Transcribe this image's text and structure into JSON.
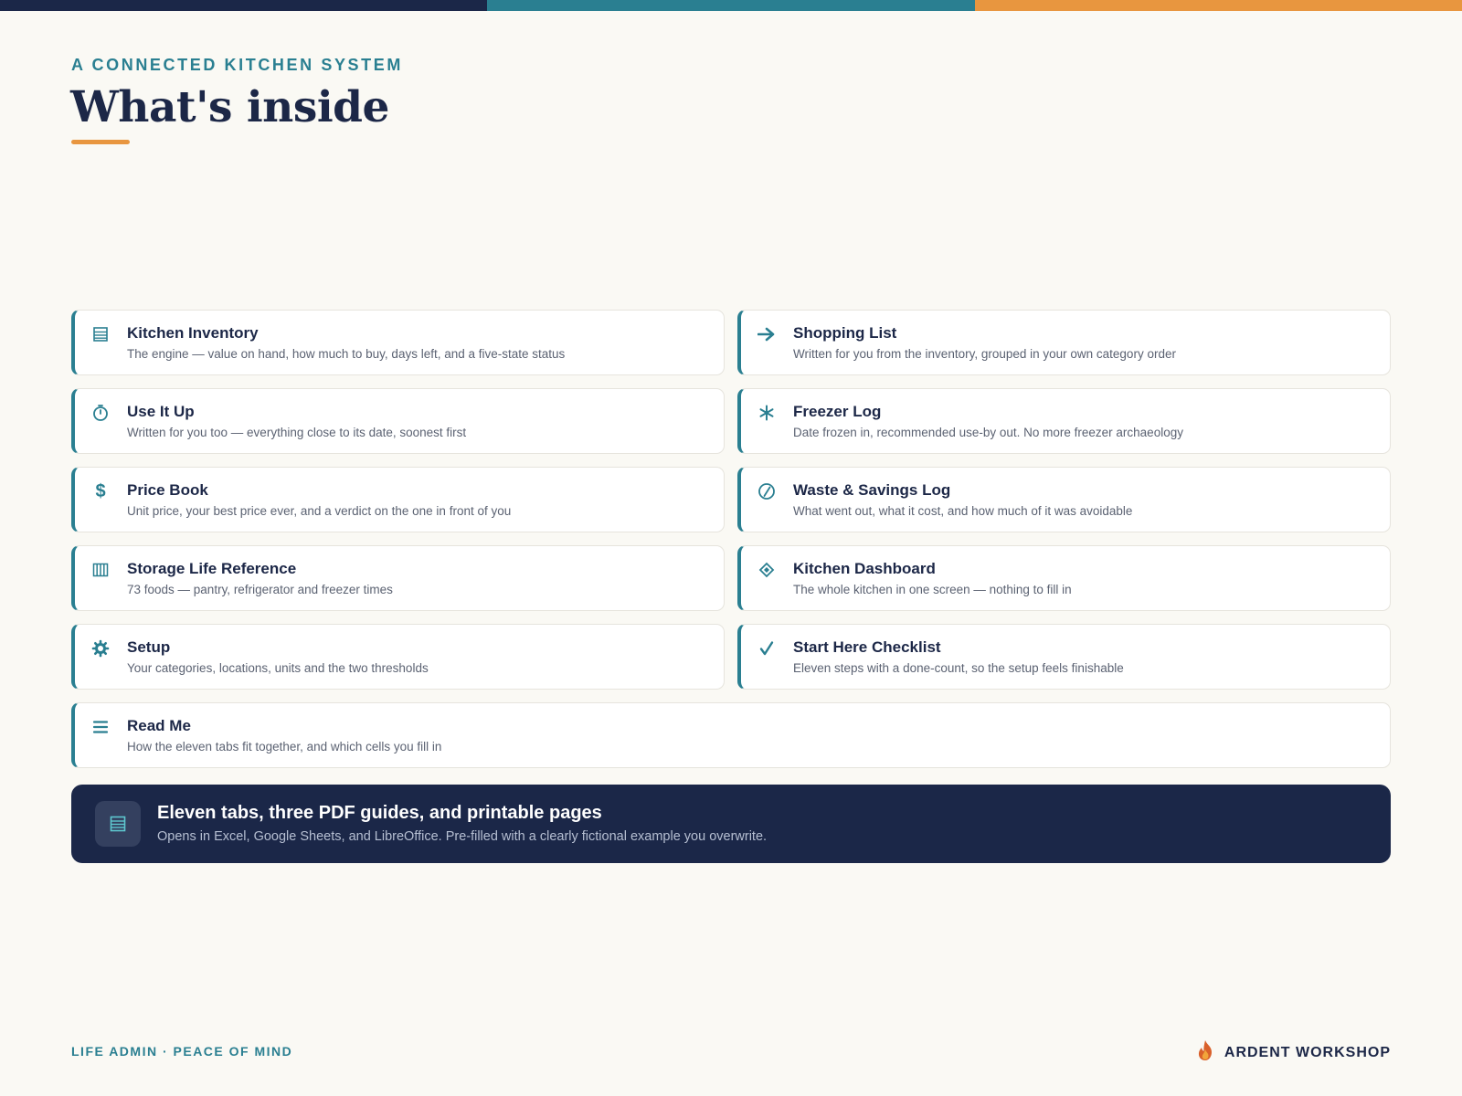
{
  "colors": {
    "navy": "#1b2748",
    "teal": "#2a7f91",
    "orange": "#e8963f",
    "background": "#faf9f4"
  },
  "header": {
    "eyebrow": "A CONNECTED KITCHEN SYSTEM",
    "title": "What's inside"
  },
  "cards": [
    {
      "icon": "list-icon",
      "title": "Kitchen Inventory",
      "desc": "The engine — value on hand, how much to buy, days left, and a five-state status"
    },
    {
      "icon": "arrow-right-icon",
      "title": "Shopping List",
      "desc": "Written for you from the inventory, grouped in your own category order"
    },
    {
      "icon": "stopwatch-icon",
      "title": "Use It Up",
      "desc": "Written for you too — everything close to its date, soonest first"
    },
    {
      "icon": "snowflake-icon",
      "title": "Freezer Log",
      "desc": "Date frozen in, recommended use-by out. No more freezer archaeology"
    },
    {
      "icon": "dollar-icon",
      "title": "Price Book",
      "desc": "Unit price, your best price ever, and a verdict on the one in front of you"
    },
    {
      "icon": "no-waste-icon",
      "title": "Waste & Savings Log",
      "desc": "What went out, what it cost, and how much of it was avoidable"
    },
    {
      "icon": "columns-icon",
      "title": "Storage Life Reference",
      "desc": "73 foods — pantry, refrigerator and freezer times"
    },
    {
      "icon": "diamond-icon",
      "title": "Kitchen Dashboard",
      "desc": "The whole kitchen in one screen — nothing to fill in"
    },
    {
      "icon": "gear-icon",
      "title": "Setup",
      "desc": "Your categories, locations, units and the two thresholds"
    },
    {
      "icon": "checkmark-icon",
      "title": "Start Here Checklist",
      "desc": "Eleven steps with a done-count, so the setup feels finishable"
    },
    {
      "icon": "menu-lines-icon",
      "title": "Read Me",
      "desc": "How the eleven tabs fit together, and which cells you fill in"
    }
  ],
  "banner": {
    "icon": "spreadsheet-icon",
    "title": "Eleven tabs, three PDF guides, and printable pages",
    "subtitle": "Opens in Excel, Google Sheets, and LibreOffice. Pre-filled with a clearly fictional example you overwrite."
  },
  "footer": {
    "tagline": "LIFE ADMIN · PEACE OF MIND",
    "brand": "ARDENT WORKSHOP",
    "brand_icon": "flame-logo-icon"
  }
}
